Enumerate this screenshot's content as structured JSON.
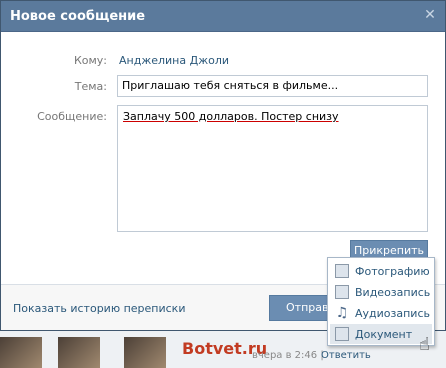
{
  "dialog": {
    "title": "Новое сообщение",
    "close_glyph": "✕",
    "to_label": "Кому:",
    "to_value": "Анджелина Джоли",
    "subject_label": "Тема:",
    "subject_value": "Приглашаю тебя сняться в фильме...",
    "message_label": "Сообщение:",
    "message_value": "Заплачу 500 долларов. Постер снизу",
    "attach_label": "Прикрепить",
    "history_link": "Показать историю переписки",
    "send_label": "Отправить"
  },
  "attach_menu": {
    "items": [
      {
        "label": "Фотографию",
        "icon": "photo-icon"
      },
      {
        "label": "Видеозапись",
        "icon": "video-icon"
      },
      {
        "label": "Аудиозапись",
        "icon": "audio-icon"
      },
      {
        "label": "Документ",
        "icon": "document-icon"
      }
    ],
    "active_item": "Документ"
  },
  "background": {
    "watermark": "Botvet.ru",
    "timestamp": "вчера в 2:46",
    "separator": "|",
    "reply_link": "Ответить"
  },
  "colors": {
    "titlebar": "#5b7a9c",
    "link": "#2b587a",
    "button": "#6b8db2"
  }
}
